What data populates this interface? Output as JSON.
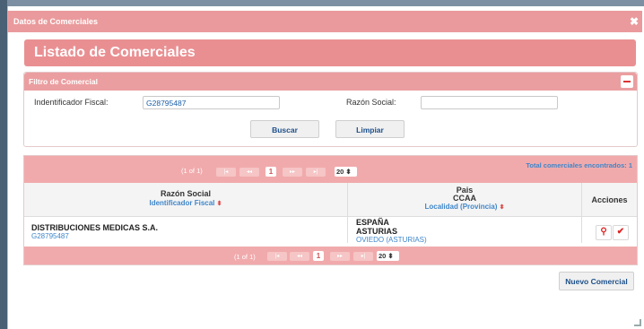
{
  "dialog": {
    "title": "Datos de Comerciales",
    "close": "✖"
  },
  "header": {
    "title": "Listado de Comerciales"
  },
  "filter": {
    "title": "Filtro de Comercial",
    "id_label": "Indentificador Fiscal:",
    "id_value": "G28795487",
    "razon_label": "Razón Social:",
    "razon_value": "",
    "buscar": "Buscar",
    "limpiar": "Limpiar"
  },
  "pager_top": {
    "info": "(1 of 1)",
    "first": "|◂",
    "prev": "◂◂",
    "page": "1",
    "next": "▸▸",
    "last": "▸|",
    "per_page": "20 ⬍"
  },
  "pager_bottom": {
    "info": "(1 of 1)",
    "first": "|◂",
    "prev": "◂◂",
    "page": "1",
    "next": "▸▸",
    "last": "▸|",
    "per_page": "20 ⬍"
  },
  "total": "Total comerciales encontrados: 1",
  "columns": {
    "razon": "Razón Social",
    "identificador": "Identificador Fiscal",
    "pais": "Pais",
    "ccaa": "CCAA",
    "localidad": "Localidad (Provincia)",
    "acciones": "Acciones"
  },
  "rows": [
    {
      "razon": "DISTRIBUCIONES MEDICAS S.A.",
      "identificador": "G28795487",
      "pais": "ESPAÑA",
      "ccaa": "ASTURIAS",
      "localidad": "OVIEDO  (ASTURIAS)"
    }
  ],
  "nuevo": "Nuevo Comercial",
  "sort_glyph": "⬍",
  "colors": {
    "accent": "#ea9a9c",
    "header": "#e98f92",
    "link": "#3f86c9",
    "action": "#d22222"
  }
}
